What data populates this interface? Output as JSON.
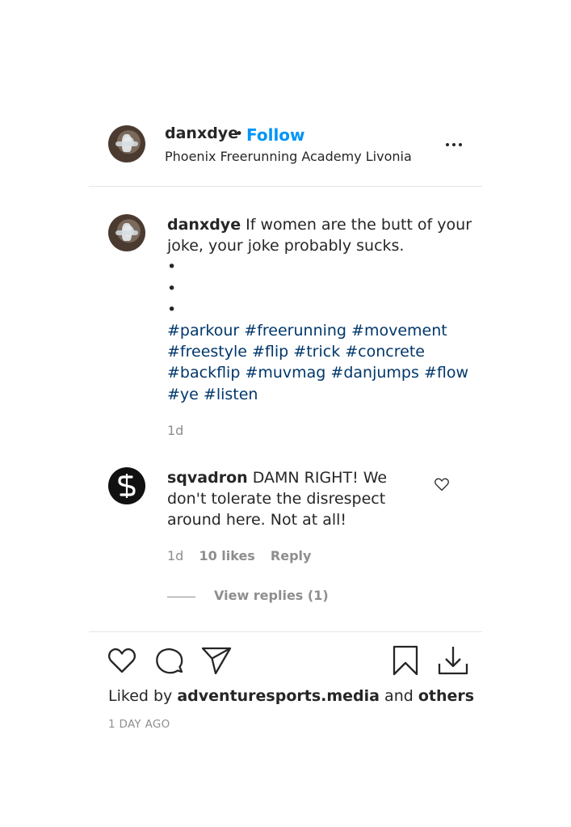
{
  "post": {
    "author": {
      "username": "danxdye",
      "separator": "•",
      "follow_label": "Follow",
      "location": "Phoenix Freerunning Academy Livonia"
    },
    "more_icon": "more-horizontal-icon",
    "caption": {
      "username": "danxdye",
      "text": "If women are the butt of your joke, your joke probably sucks.",
      "bullets": [
        "•",
        "•",
        "•"
      ],
      "hashtags": [
        "#parkour",
        "#freerunning",
        "#movement",
        "#freestyle",
        "#flip",
        "#trick",
        "#concrete",
        "#backflip",
        "#muvmag",
        "#danjumps",
        "#flow",
        "#ye",
        "#listen"
      ],
      "time": "1d"
    },
    "comments": [
      {
        "username": "sqvadron",
        "text": "DAMN RIGHT! We don't tolerate the disrespect around here. Not at all!",
        "time": "1d",
        "likes": "10 likes",
        "reply_label": "Reply",
        "view_replies": "View replies (1)"
      }
    ],
    "actions": {
      "like_icon": "heart-icon",
      "comment_icon": "comment-bubble-icon",
      "share_icon": "paper-plane-icon",
      "save_icon": "bookmark-icon",
      "download_icon": "download-icon"
    },
    "liked_by": {
      "prefix": "Liked by",
      "user": "adventuresports.media",
      "conjunction": "and",
      "others": "others"
    },
    "timestamp": "1 DAY AGO"
  },
  "colors": {
    "link_blue": "#0095f6",
    "hashtag_blue": "#00376b",
    "text": "#262626",
    "muted": "#8e8e8e",
    "divider": "#e6e6e6"
  }
}
